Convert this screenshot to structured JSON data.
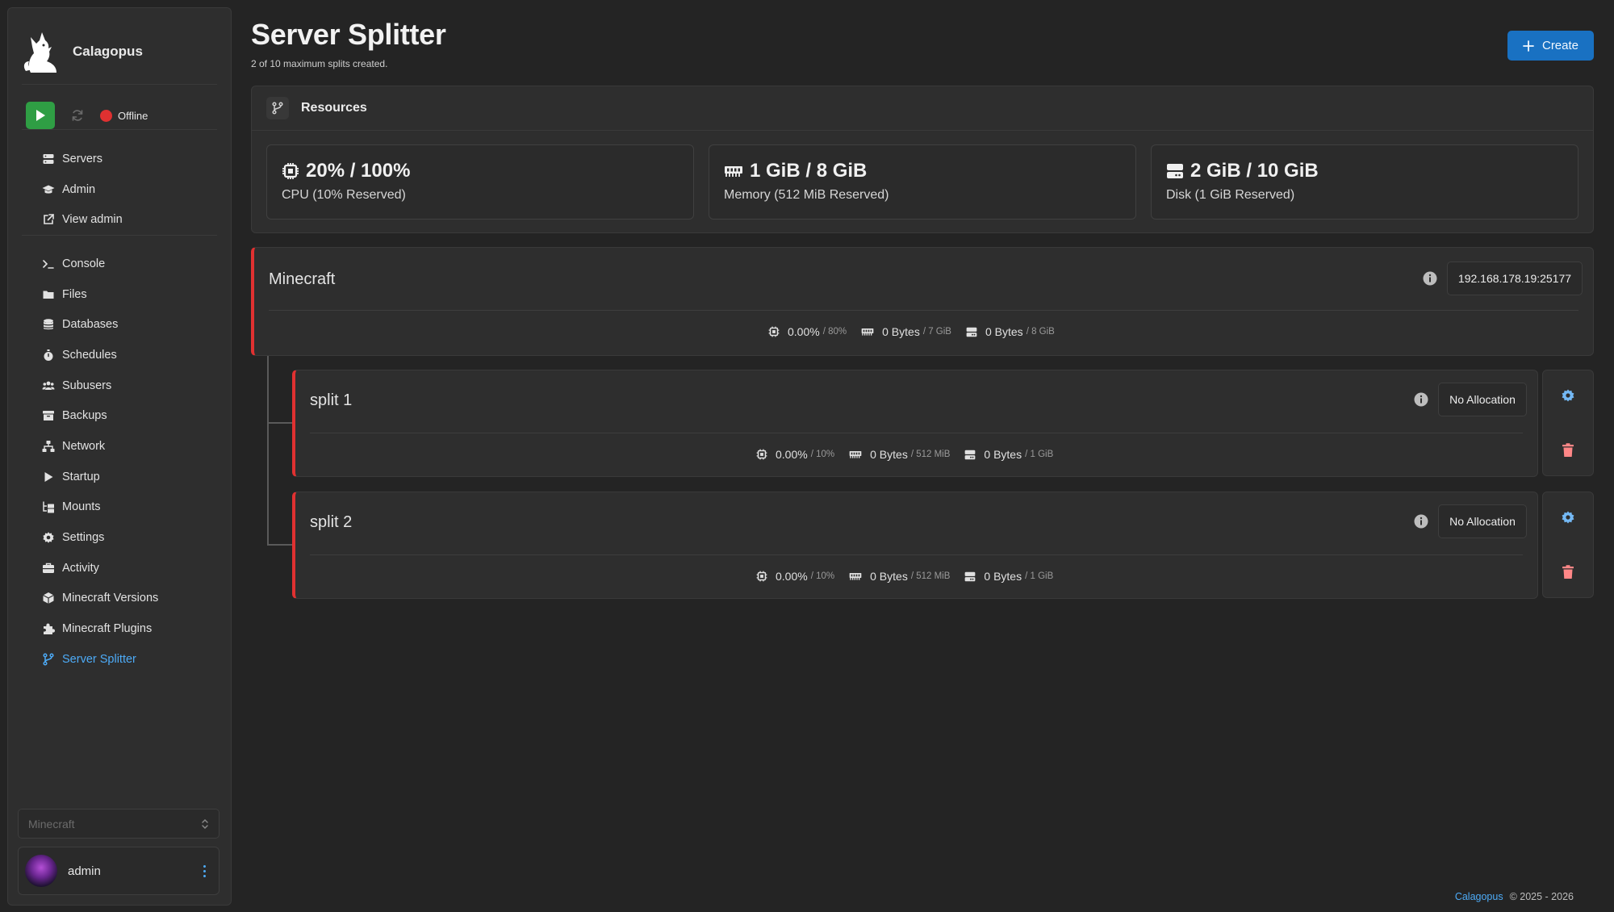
{
  "brand": {
    "name": "Calagopus"
  },
  "power": {
    "status": "Offline"
  },
  "nav_top": [
    {
      "label": "Servers",
      "icon": "server-icon"
    },
    {
      "label": "Admin",
      "icon": "graduation-cap-icon"
    },
    {
      "label": "View admin",
      "icon": "external-link-icon"
    }
  ],
  "nav_server": [
    {
      "label": "Console",
      "icon": "terminal-icon"
    },
    {
      "label": "Files",
      "icon": "folder-icon"
    },
    {
      "label": "Databases",
      "icon": "database-icon"
    },
    {
      "label": "Schedules",
      "icon": "stopwatch-icon"
    },
    {
      "label": "Subusers",
      "icon": "users-icon"
    },
    {
      "label": "Backups",
      "icon": "archive-icon"
    },
    {
      "label": "Network",
      "icon": "network-icon"
    },
    {
      "label": "Startup",
      "icon": "play-icon"
    },
    {
      "label": "Mounts",
      "icon": "folder-tree-icon"
    },
    {
      "label": "Settings",
      "icon": "gear-icon"
    },
    {
      "label": "Activity",
      "icon": "briefcase-icon"
    },
    {
      "label": "Minecraft Versions",
      "icon": "cube-icon"
    },
    {
      "label": "Minecraft Plugins",
      "icon": "puzzle-icon"
    },
    {
      "label": "Server Splitter",
      "icon": "code-branch-icon",
      "active": true
    }
  ],
  "server_select": {
    "value": "Minecraft"
  },
  "user": {
    "name": "admin"
  },
  "page": {
    "title": "Server Splitter",
    "subtitle": "2 of 10 maximum splits created.",
    "create_label": "Create"
  },
  "resources": {
    "title": "Resources",
    "cards": [
      {
        "value": "20% / 100%",
        "sub": "CPU (10% Reserved)",
        "icon": "cpu-icon"
      },
      {
        "value": "1 GiB / 8 GiB",
        "sub": "Memory (512 MiB Reserved)",
        "icon": "memory-icon"
      },
      {
        "value": "2 GiB / 10 GiB",
        "sub": "Disk (1 GiB Reserved)",
        "icon": "hard-drive-icon"
      }
    ]
  },
  "servers": [
    {
      "name": "Minecraft",
      "allocation": "192.168.178.19:25177",
      "cpu": "0.00%",
      "cpu_limit": "/ 80%",
      "mem": "0 Bytes",
      "mem_limit": "/ 7 GiB",
      "disk": "0 Bytes",
      "disk_limit": "/ 8 GiB"
    },
    {
      "name": "split 1",
      "allocation": "No Allocation",
      "cpu": "0.00%",
      "cpu_limit": "/ 10%",
      "mem": "0 Bytes",
      "mem_limit": "/ 512 MiB",
      "disk": "0 Bytes",
      "disk_limit": "/ 1 GiB"
    },
    {
      "name": "split 2",
      "allocation": "No Allocation",
      "cpu": "0.00%",
      "cpu_limit": "/ 10%",
      "mem": "0 Bytes",
      "mem_limit": "/ 512 MiB",
      "disk": "0 Bytes",
      "disk_limit": "/ 1 GiB"
    }
  ],
  "footer": {
    "brand": "Calagopus",
    "copyright": "© 2025 - 2026"
  },
  "colors": {
    "accent": "#4dabf7",
    "primary": "#1971c2",
    "danger": "#e03131",
    "success": "#2f9e44"
  }
}
